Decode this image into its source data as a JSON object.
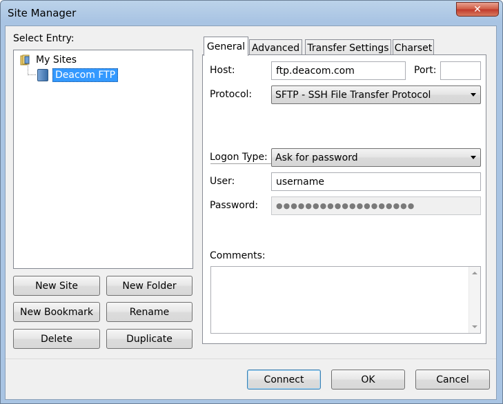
{
  "window": {
    "title": "Site Manager"
  },
  "entry": {
    "label": "Select Entry:",
    "tree": {
      "root": "My Sites",
      "child": "Deacom FTP"
    }
  },
  "left_buttons": {
    "new_site": "New Site",
    "new_folder": "New Folder",
    "new_bookmark": "New Bookmark",
    "rename": "Rename",
    "delete": "Delete",
    "duplicate": "Duplicate"
  },
  "tabs": [
    "General",
    "Advanced",
    "Transfer Settings",
    "Charset"
  ],
  "general": {
    "host_label": "Host:",
    "host_value": "ftp.deacom.com",
    "port_label": "Port:",
    "port_value": "",
    "protocol_label": "Protocol:",
    "protocol_value": "SFTP - SSH File Transfer Protocol",
    "logon_label": "Logon Type:",
    "logon_value": "Ask for password",
    "user_label": "User:",
    "user_value": "username",
    "password_label": "Password:",
    "password_value": "●●●●●●●●●●●●●●●●●●●",
    "comments_label": "Comments:",
    "comments_value": ""
  },
  "dialog_buttons": {
    "connect": "Connect",
    "ok": "OK",
    "cancel": "Cancel"
  },
  "icons": {
    "close": "close-icon",
    "folder": "folder-icon",
    "server": "server-icon"
  }
}
